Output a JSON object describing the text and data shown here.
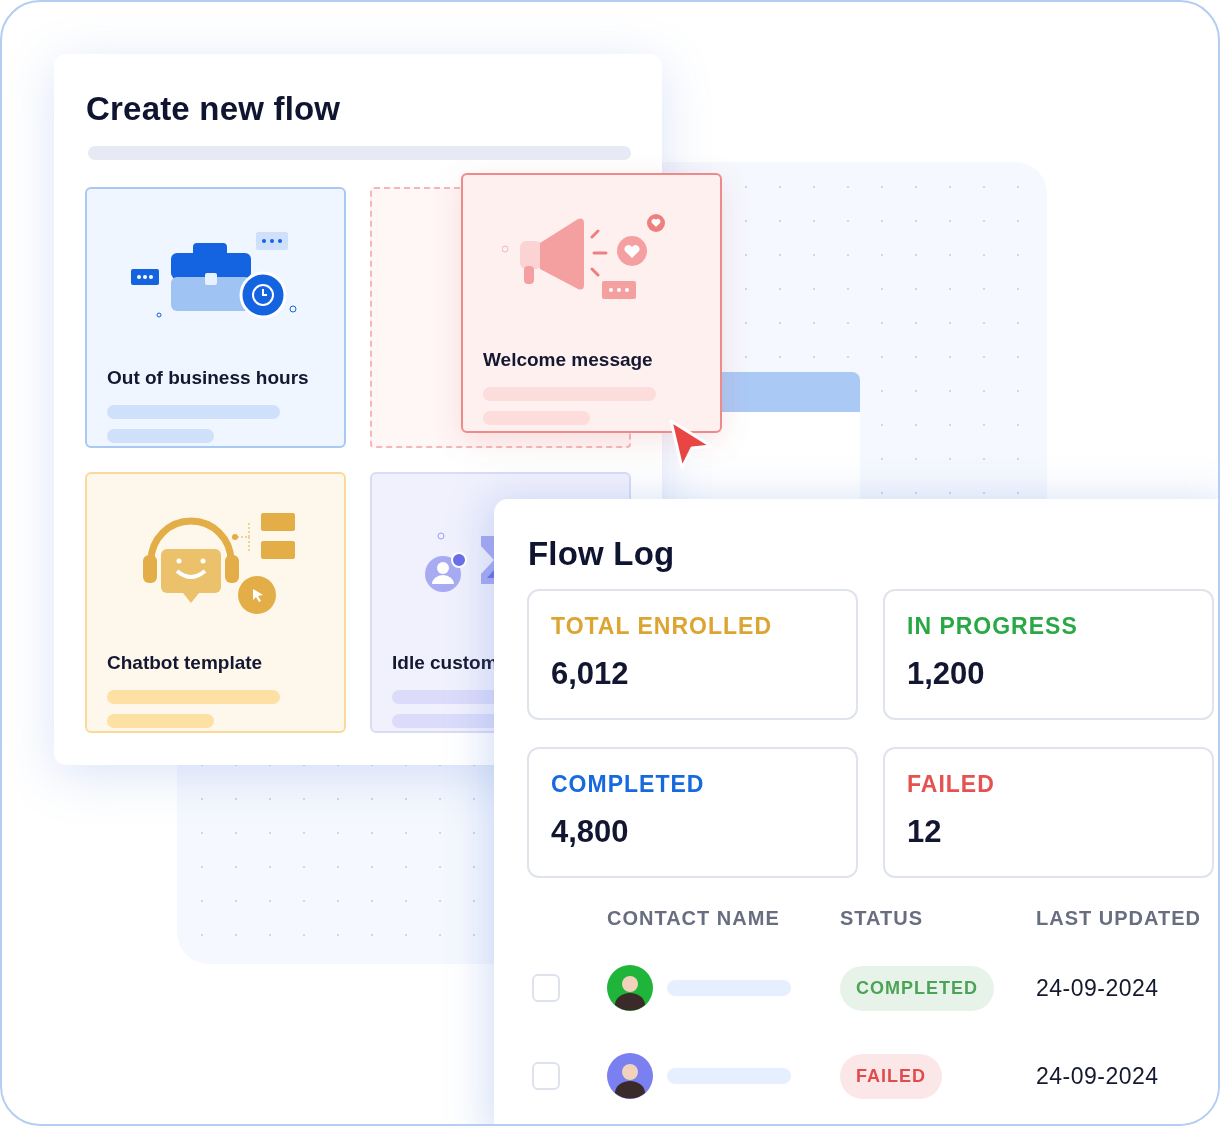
{
  "create_flow": {
    "title": "Create new flow",
    "cards": [
      {
        "label": "Out of business hours",
        "kind": "business"
      },
      {
        "kind": "placeholder"
      },
      {
        "label": "Chatbot template",
        "kind": "chatbot"
      },
      {
        "label": "Idle custom",
        "kind": "idle"
      }
    ],
    "dragged_card": {
      "label": "Welcome message",
      "kind": "welcome"
    }
  },
  "flow_log": {
    "title": "Flow Log",
    "stats": [
      {
        "label": "TOTAL ENROLLED",
        "value": "6,012",
        "color": "#dca532"
      },
      {
        "label": "IN PROGRESS",
        "value": "1,200",
        "color": "#2aa845"
      },
      {
        "label": "COMPLETED",
        "value": "4,800",
        "color": "#1769e0"
      },
      {
        "label": "FAILED",
        "value": "12",
        "color": "#e5524f"
      }
    ],
    "table": {
      "columns": [
        "CONTACT NAME",
        "STATUS",
        "LAST UPDATED"
      ],
      "rows": [
        {
          "checked": false,
          "status": {
            "label": "COMPLETED",
            "color": "#4aa356"
          },
          "date": "24-09-2024"
        },
        {
          "checked": false,
          "status": {
            "label": "FAILED",
            "color": "#e04c4c"
          },
          "date": "24-09-2024"
        }
      ]
    }
  }
}
